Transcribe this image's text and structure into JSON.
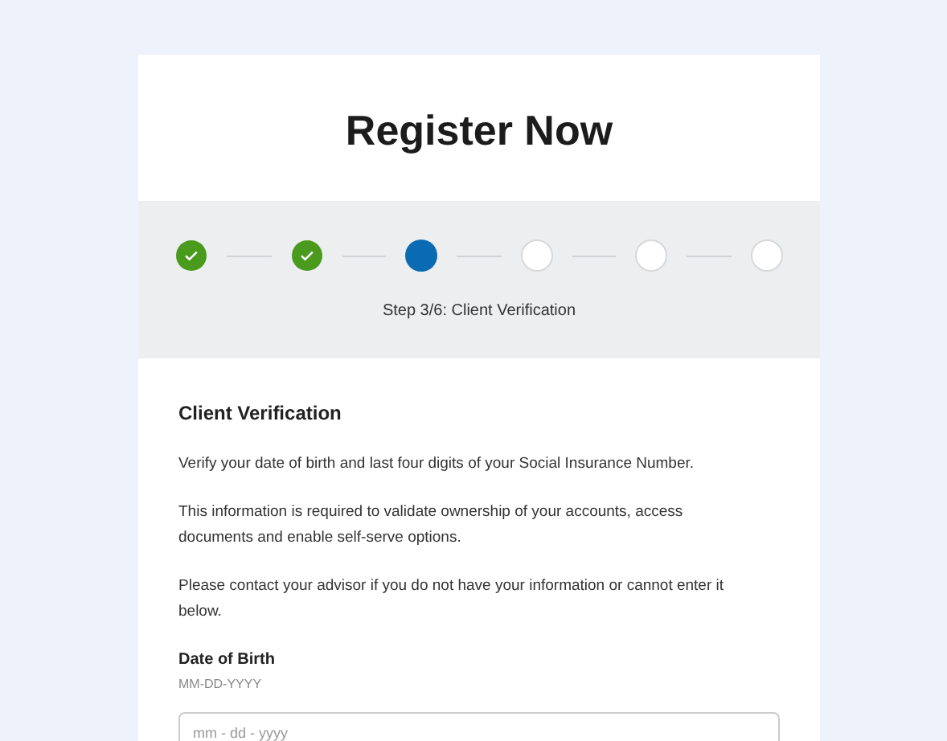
{
  "title": "Register Now",
  "steps": [
    {
      "kind": "done"
    },
    {
      "kind": "done"
    },
    {
      "kind": "current"
    },
    {
      "kind": "todo"
    },
    {
      "kind": "todo"
    },
    {
      "kind": "todo"
    }
  ],
  "step_caption": "Step 3/6: Client Verification",
  "section_heading": "Client Verification",
  "paragraphs": [
    "Verify your date of birth and last four digits of your Social Insurance Number.",
    "This information is required to validate ownership of your accounts, access documents and enable self-serve options.",
    "Please contact your advisor if you do not have your information or cannot enter it below."
  ],
  "dob_field": {
    "label": "Date of Birth",
    "hint": "MM-DD-YYYY",
    "placeholder": "mm - dd - yyyy"
  }
}
